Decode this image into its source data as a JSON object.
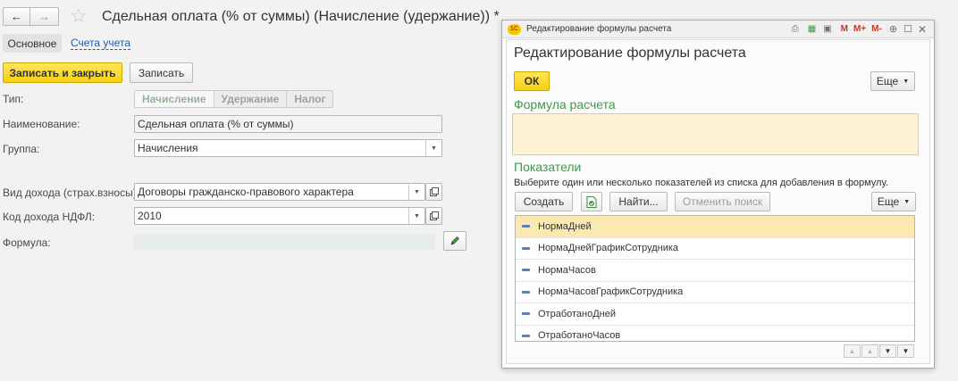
{
  "main": {
    "title": "Сдельная оплата (% от суммы) (Начисление (удержание)) *",
    "tabs": [
      {
        "label": "Основное"
      },
      {
        "label": "Счета учета"
      }
    ],
    "buttons": {
      "save_close": "Записать и закрыть",
      "save": "Записать"
    },
    "fields": {
      "type_label": "Тип:",
      "type_options": [
        "Начисление",
        "Удержание",
        "Налог"
      ],
      "type_selected": "Начисление",
      "name_label": "Наименование:",
      "name_value": "Сдельная оплата (% от суммы)",
      "group_label": "Группа:",
      "group_value": "Начисления",
      "income_type_label": "Вид дохода (страх.взносы):",
      "income_type_value": "Договоры гражданско-правового характера",
      "ndfl_label": "Код дохода НДФЛ:",
      "ndfl_value": "2010",
      "formula_label": "Формула:",
      "formula_value": ""
    }
  },
  "dialog": {
    "window_title": "Редактирование формулы расчета",
    "titlebar_buttons": [
      "M",
      "M+",
      "M-"
    ],
    "heading": "Редактирование формулы расчета",
    "ok_label": "ОК",
    "more_label": "Еще",
    "formula_section": "Формула расчета",
    "formula_value": "",
    "indicators_section": "Показатели",
    "hint": "Выберите один или несколько показателей из списка для добавления в формулу.",
    "toolbar": {
      "create": "Создать",
      "find": "Найти...",
      "cancel_search": "Отменить поиск",
      "more": "Еще"
    },
    "items": [
      {
        "label": "НормаДней",
        "selected": true
      },
      {
        "label": "НормаДнейГрафикСотрудника",
        "selected": false
      },
      {
        "label": "НормаЧасов",
        "selected": false
      },
      {
        "label": "НормаЧасовГрафикСотрудника",
        "selected": false
      },
      {
        "label": "ОтработаноДней",
        "selected": false
      },
      {
        "label": "ОтработаноЧасов",
        "selected": false
      }
    ]
  },
  "colors": {
    "accent_yellow": "#f5cf12",
    "section_green": "#3e9a4a",
    "link_blue": "#1f5fa8",
    "selected_row": "#fbe9b1"
  }
}
